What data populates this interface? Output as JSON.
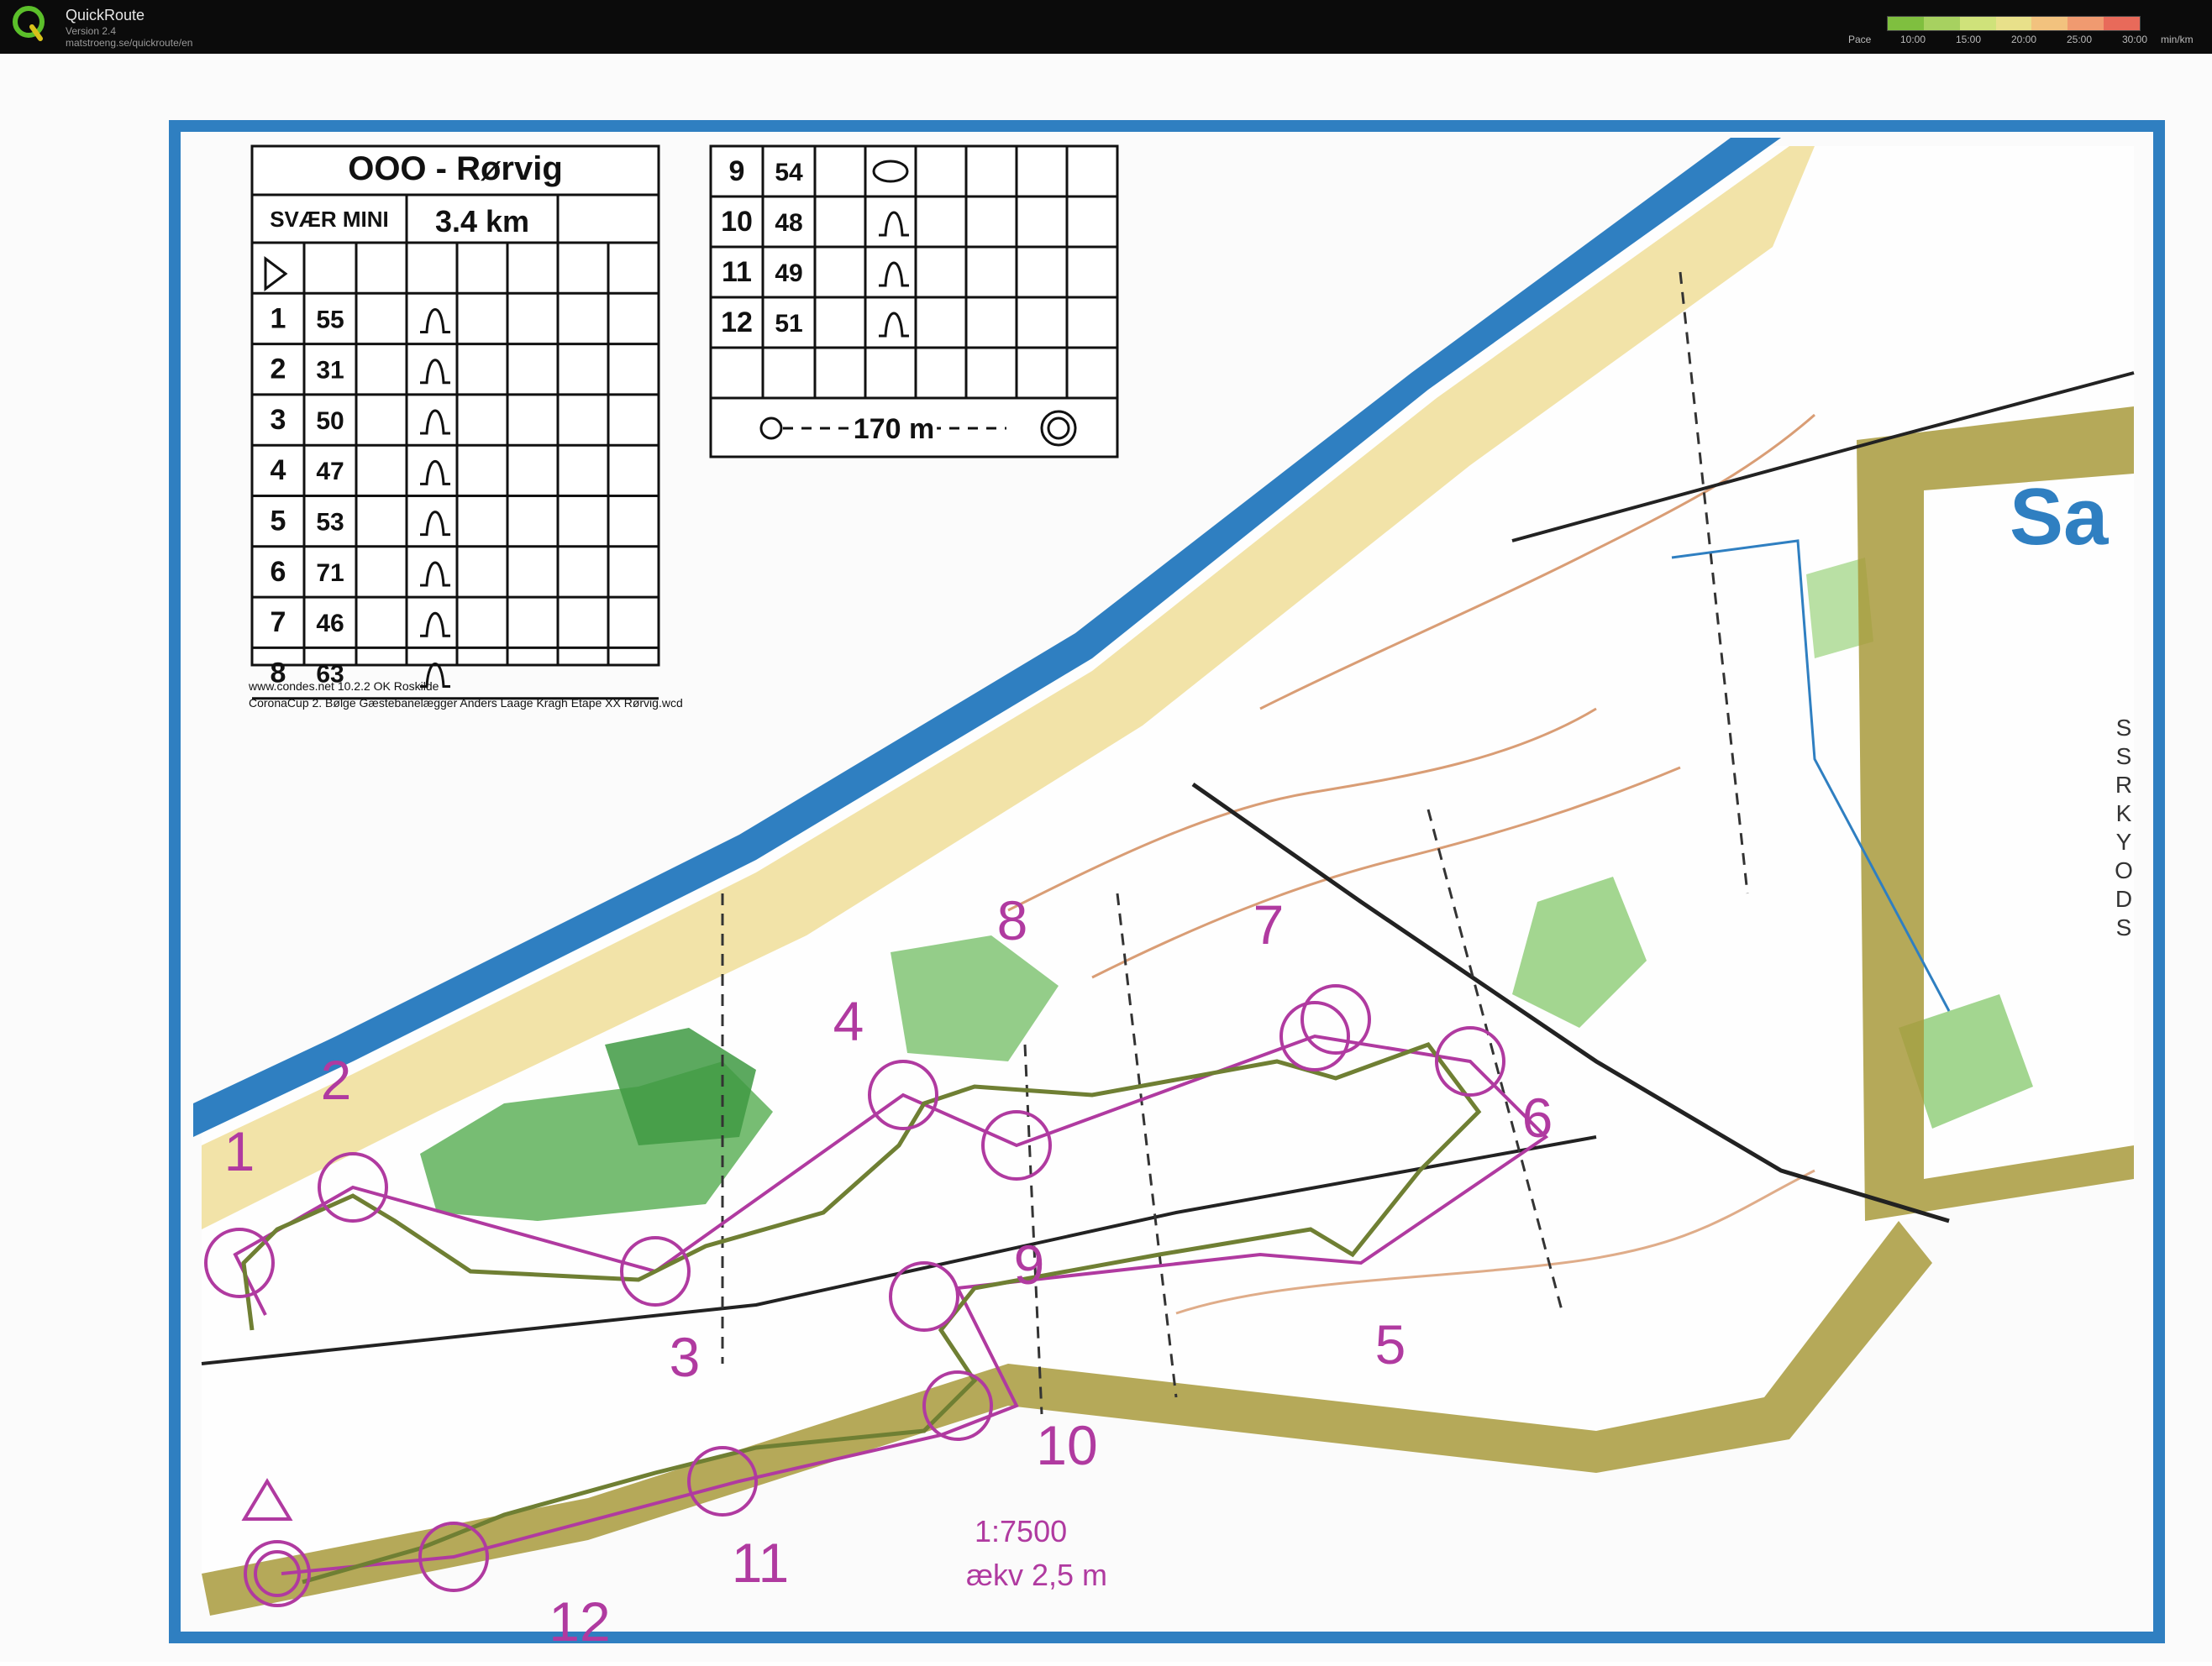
{
  "app": {
    "name": "QuickRoute",
    "version": "Version 2.4",
    "url": "matstroeng.se/quickroute/en"
  },
  "pace_legend": {
    "label": "Pace",
    "ticks": [
      "10:00",
      "15:00",
      "20:00",
      "25:00",
      "30:00"
    ],
    "unit": "min/km",
    "colors": [
      "#7fbf3f",
      "#a7d160",
      "#cfe27a",
      "#e8e08a",
      "#f2c27e",
      "#f09a70",
      "#e86a5a"
    ]
  },
  "map": {
    "title": "OOO - Rørvig",
    "course": "SVÆR MINI",
    "length": "3.4 km",
    "controls": [
      {
        "n": "1",
        "code": "55"
      },
      {
        "n": "2",
        "code": "31"
      },
      {
        "n": "3",
        "code": "50"
      },
      {
        "n": "4",
        "code": "47"
      },
      {
        "n": "5",
        "code": "53"
      },
      {
        "n": "6",
        "code": "71"
      },
      {
        "n": "7",
        "code": "46"
      },
      {
        "n": "8",
        "code": "63"
      },
      {
        "n": "9",
        "code": "54"
      },
      {
        "n": "10",
        "code": "48"
      },
      {
        "n": "11",
        "code": "49"
      },
      {
        "n": "12",
        "code": "51"
      }
    ],
    "finish_distance": "170 m",
    "footer_line1": "www.condes.net 10.2.2 OK Roskilde",
    "footer_line2": "CoronaCup 2. Bølge Gæstebanelægger Anders Laage Kragh Etape XX Rørvig.wcd",
    "scale": "1:7500",
    "contour": "ækv 2,5 m",
    "place_name": "Sa",
    "vertical_letters": [
      "S",
      "S",
      "R",
      "K",
      "Y",
      "O",
      "D",
      "S"
    ]
  }
}
